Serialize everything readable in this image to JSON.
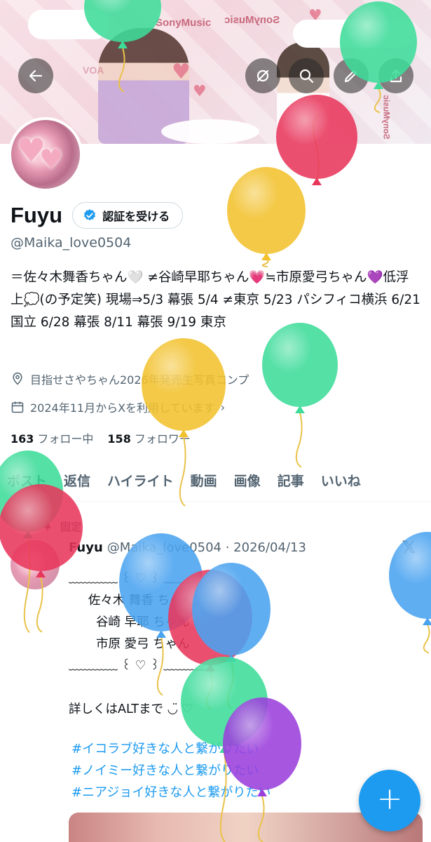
{
  "header": {
    "banner_logos": [
      "SonyMusic",
      "SonyMusic",
      "SonyMusic",
      "VOA"
    ],
    "buttons": {
      "back": "arrow-left-icon",
      "mute": "slash-circle-icon",
      "search": "search-icon",
      "edit": "pencil-icon",
      "share": "share-icon"
    }
  },
  "profile": {
    "name": "Fuyu",
    "verify_label": "認証を受ける",
    "handle": "@Maika_love0504",
    "bio": "＝佐々木舞香ちゃん🤍 ≠谷崎早耶ちゃん💗≒市原愛弓ちゃん💜低浮上💭(の予定笑) 現場⇒5/3 幕張 5/4 ≠東京 5/23 パシフィコ横浜 6/21 国立 6/28 幕張 8/11 幕張 9/19 東京",
    "location": "目指せさやちゃん2026年発売生写真コンプ",
    "joined": "2024年11月からXを利用しています",
    "following_count": "163",
    "following_label": "フォロー中",
    "followers_count": "158",
    "followers_label": "フォロワー"
  },
  "tabs": [
    "ポスト",
    "返信",
    "ハイライト",
    "動画",
    "画像",
    "記事",
    "いいね"
  ],
  "pinned_post": {
    "pinned_label": "固定",
    "author": "Fuyu",
    "handle_date": "@Maika_love0504 · 2026/04/13",
    "body": "﹏﹏﹏﹏ ꒰ ♡ ꒱ ﹏﹏﹏﹏\n     佐々木 舞香 ちゃん\n       谷崎 早耶 ちゃん\n       市原 愛弓 ちゃん\n﹏﹏﹏﹏ ꒰ ♡ ꒱ ﹏﹏﹏﹏\n\n詳しくはALTまで ◡̈ ♡",
    "hashtags": [
      "#イコラブ好きな人と繋がりたい",
      "#ノイミー好きな人と繋がりたい",
      "#ニアジョイ好きな人と繋がりたい"
    ]
  },
  "fab": {
    "label": "+"
  },
  "colors": {
    "accent": "#1d9bf0",
    "text": "#0f1419",
    "secondary": "#536471",
    "balloon_colors": [
      "#3ddc9a",
      "#e8375c",
      "#f2c12e",
      "#4aa3f0",
      "#9b3fdc"
    ]
  }
}
